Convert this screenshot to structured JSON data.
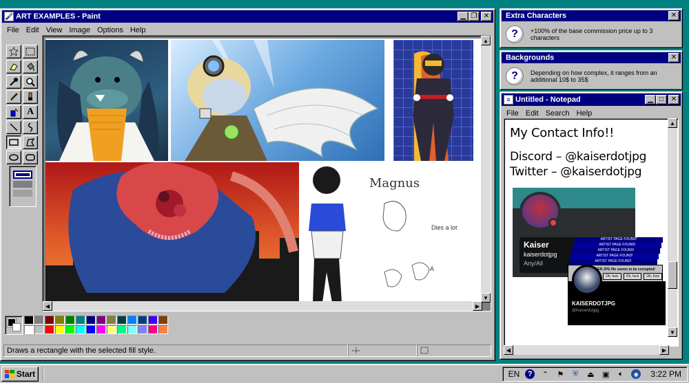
{
  "paint": {
    "title": "ART EXAMPLES - Paint",
    "menu": [
      "File",
      "Edit",
      "View",
      "Image",
      "Options",
      "Help"
    ],
    "canvas_text": {
      "magnus": "Magnus",
      "dies": "Dies a lot",
      "a": "A"
    },
    "status": "Draws a rectangle with the selected fill style.",
    "palette_top": [
      "#000000",
      "#808080",
      "#800000",
      "#808000",
      "#008000",
      "#008080",
      "#000080",
      "#800080",
      "#808040",
      "#004040",
      "#0080ff",
      "#004080",
      "#4000ff",
      "#804000"
    ],
    "palette_bottom": [
      "#ffffff",
      "#c0c0c0",
      "#ff0000",
      "#ffff00",
      "#00ff00",
      "#00ffff",
      "#0000ff",
      "#ff00ff",
      "#ffff80",
      "#00ff80",
      "#80ffff",
      "#8080ff",
      "#ff0080",
      "#ff8040"
    ]
  },
  "extra": {
    "title": "Extra Characters",
    "text": "+100% of the base commission price up to 3 characters"
  },
  "backgrounds": {
    "title": "Backgrounds",
    "text": "Depending on how complex, it ranges from an additional 10$ to 35$"
  },
  "notepad": {
    "title": "Untitled - Notepad",
    "menu": [
      "File",
      "Edit",
      "Search",
      "Help"
    ],
    "heading": "My Contact Info!!",
    "discord": "Discord – @kaiserdotjpg",
    "twitter": "Twitter – @kaiserdotjpg",
    "discord_card": {
      "name": "Kaiser",
      "handle": "kaiserdotjpg",
      "pronouns": "Any/All"
    },
    "twitter_card": {
      "name": "KAISERDOTJPG",
      "handle": "@Kaiserdotjpg"
    },
    "popup_title": "ARTIST PAGE FOUND!",
    "popup_text": "The KAISER.JPG file seems to be corrupted!",
    "popup_buttons": [
      "Oh, fuck",
      "Oh, fuck",
      "Oh, fuck"
    ]
  },
  "taskbar": {
    "start": "Start",
    "lang": "EN",
    "time": "3:22 PM"
  }
}
